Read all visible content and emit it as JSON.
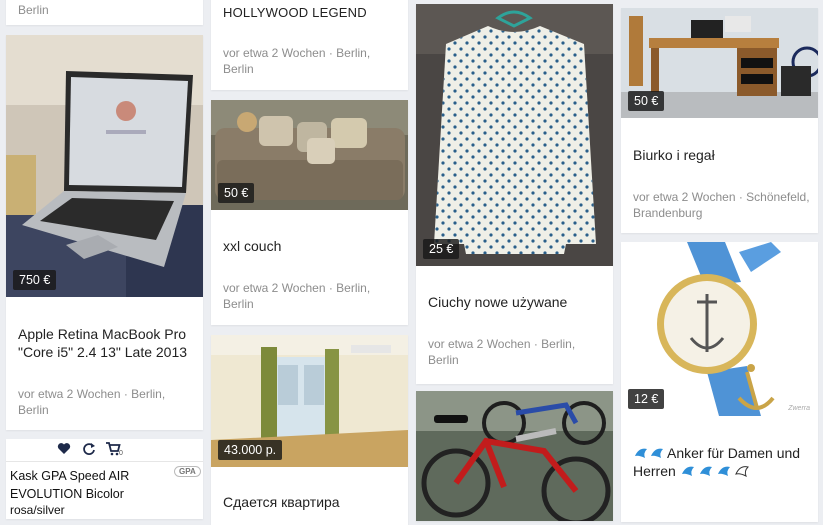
{
  "listings": [
    {
      "id": "top-left",
      "meta": "Berlin"
    },
    {
      "id": "macbook",
      "price": "750 €",
      "title": "Apple Retina MacBook Pro \"Core i5\" 2.4 13\" Late 2013",
      "meta": "vor etwa 2 Wochen · Berlin, Berlin"
    },
    {
      "id": "kask",
      "title": "Kask GPA Speed AIR EVOLUTION Bicolor",
      "subtitle": "rosa/silver",
      "brand": "GPA",
      "cart_count": "0"
    },
    {
      "id": "hollywood",
      "title": "HOLLYWOOD LEGEND",
      "meta": "vor etwa 2 Wochen · Berlin, Berlin"
    },
    {
      "id": "couch",
      "price": "50 €",
      "title": "xxl couch",
      "meta": "vor etwa 2 Wochen · Berlin, Berlin"
    },
    {
      "id": "apartment",
      "price": "43.000 р.",
      "title": "Сдается квартира"
    },
    {
      "id": "sweater",
      "price": "25 €",
      "title": "Ciuchy nowe używane",
      "meta": "vor etwa 2 Wochen · Berlin, Berlin"
    },
    {
      "id": "bikes"
    },
    {
      "id": "desk",
      "price": "50 €",
      "title": "Biurko i regał",
      "meta": "vor etwa 2 Wochen · Schönefeld, Brandenburg"
    },
    {
      "id": "watch",
      "price": "12 €",
      "title": "Anker für Damen und Herren",
      "watermark": "Zwerra"
    }
  ],
  "colors": {
    "page_bg": "#eceef2",
    "card_bg": "#ffffff",
    "price_badge": "#1e1e1e",
    "meta_text": "#8d8d8d",
    "emoji_blue": "#2f8fd8"
  },
  "icons": [
    "heart-icon",
    "refresh-icon",
    "cart-icon",
    "dolphin-emoji-icon"
  ]
}
